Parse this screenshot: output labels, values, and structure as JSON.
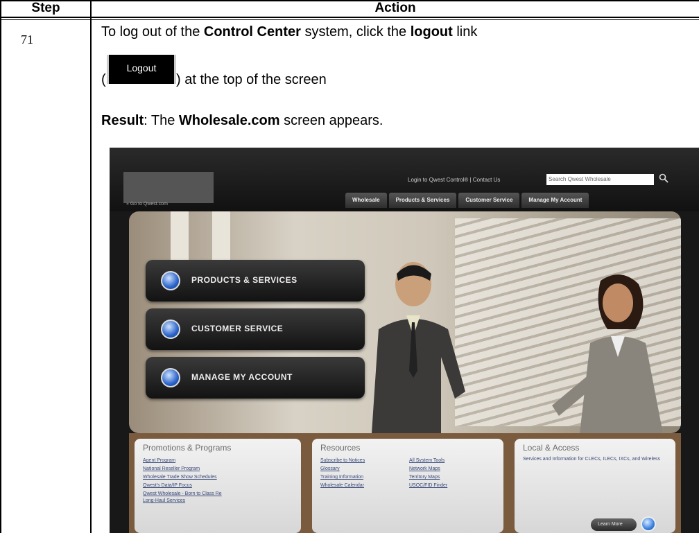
{
  "table": {
    "header_step": "Step",
    "header_action": "Action",
    "step_number": "71",
    "line1_pre": "To log out of the ",
    "line1_bold1": "Control Center",
    "line1_mid": " system, click the ",
    "line1_bold2": "logout",
    "line1_post": " link",
    "line2_open": "(",
    "logout_button_label": "Logout",
    "line2_post": ") at the top of the screen",
    "result_label": "Result",
    "result_pre": ":  The ",
    "result_bold": "Wholesale.com",
    "result_post": " screen appears."
  },
  "screenshot": {
    "top_links": "Login to Qwest Control®  |  Contact Us",
    "search_placeholder": "Search Qwest Wholesale",
    "goto_link": "» Go to Qwest.com",
    "nav_tabs": [
      "Wholesale",
      "Products & Services",
      "Customer Service",
      "Manage My Account"
    ],
    "hero_buttons": [
      "PRODUCTS & SERVICES",
      "CUSTOMER SERVICE",
      "MANAGE MY ACCOUNT"
    ],
    "panels": {
      "promotions": {
        "title": "Promotions & Programs",
        "links": [
          "Agent Program",
          "National Reseller Program",
          "Wholesale Trade Show Schedules",
          "Qwest's Data/IP Focus",
          "Qwest Wholesale - Born to Class Re",
          "Long-Haul Services"
        ]
      },
      "resources": {
        "title": "Resources",
        "links_left": [
          "Subscribe to Notices",
          "Glossary",
          "Training Information",
          "Wholesale Calendar"
        ],
        "links_right": [
          "All System Tools",
          "Network Maps",
          "Territory Maps",
          "USOC/FID Finder"
        ]
      },
      "local": {
        "title": "Local & Access",
        "text": "Services and Information for CLECs, ILECs, IXCs, and Wireless",
        "button": "Learn More"
      }
    },
    "icons": [
      "search-icon",
      "products-icon",
      "customer-service-icon",
      "account-icon",
      "learn-more-icon"
    ]
  }
}
